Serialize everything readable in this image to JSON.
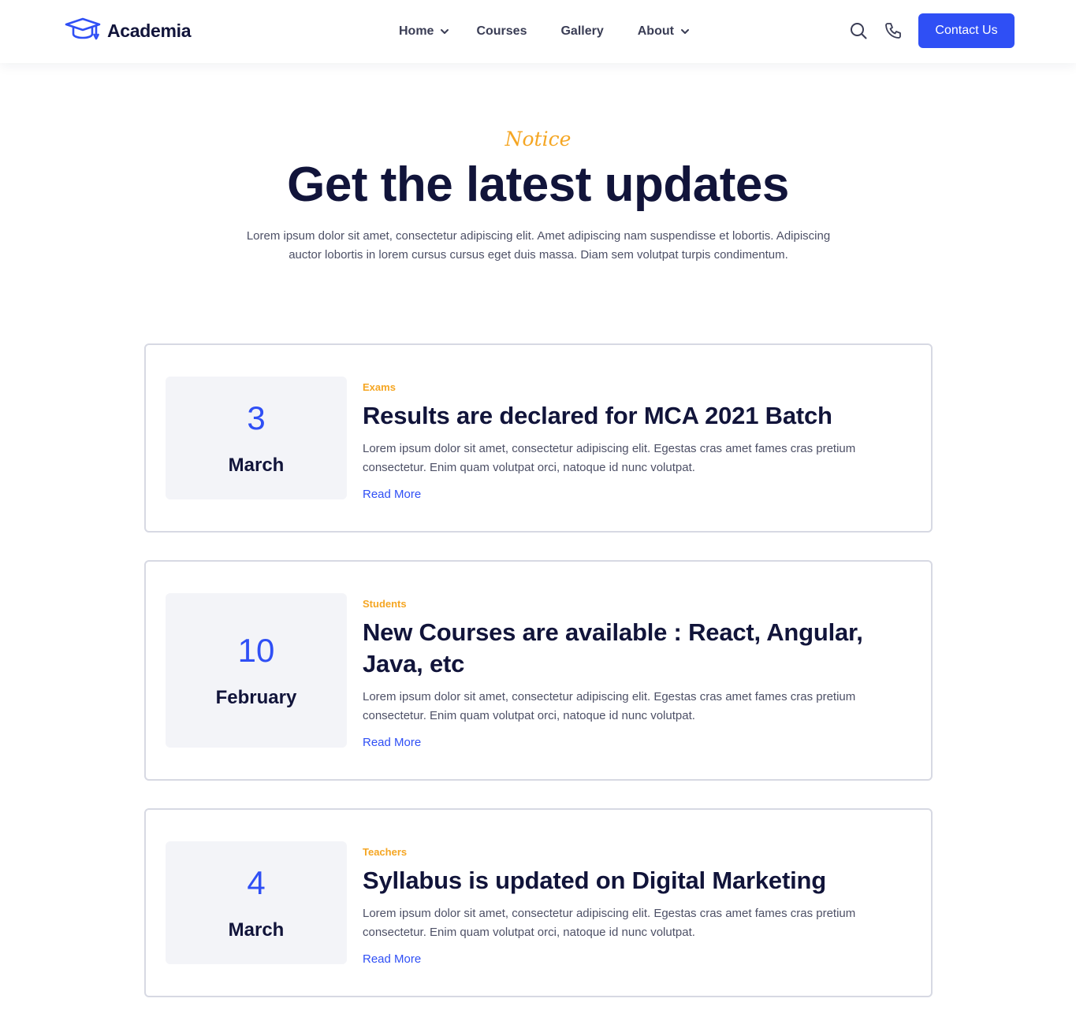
{
  "brand": {
    "name": "Academia",
    "accent": "#2f4ff5",
    "highlight": "#f5a623",
    "logo_icon": "graduation-cap-icon"
  },
  "nav": {
    "items": [
      {
        "label": "Home",
        "has_dropdown": true
      },
      {
        "label": "Courses",
        "has_dropdown": false
      },
      {
        "label": "Gallery",
        "has_dropdown": false
      },
      {
        "label": "About",
        "has_dropdown": true
      }
    ],
    "icons": [
      "search-icon",
      "phone-icon"
    ],
    "cta_label": "Contact Us"
  },
  "section": {
    "eyebrow": "Notice",
    "title": "Get the latest updates",
    "description": "Lorem ipsum dolor sit amet, consectetur adipiscing elit. Amet adipiscing nam suspendisse et lobortis. Adipiscing auctor lobortis in lorem cursus cursus eget duis massa. Diam sem volutpat turpis condimentum."
  },
  "notices": [
    {
      "day": "3",
      "month": "March",
      "category": "Exams",
      "title": "Results are declared for MCA 2021 Batch",
      "text": "Lorem ipsum dolor sit amet, consectetur adipiscing elit. Egestas cras amet fames cras pretium consectetur. Enim quam volutpat orci, natoque id nunc volutpat.",
      "link_label": "Read More"
    },
    {
      "day": "10",
      "month": "February",
      "category": "Students",
      "title": "New Courses are available : React, Angular, Java, etc",
      "text": "Lorem ipsum dolor sit amet, consectetur adipiscing elit. Egestas cras amet fames cras pretium consectetur. Enim quam volutpat orci, natoque id nunc volutpat.",
      "link_label": "Read More"
    },
    {
      "day": "4",
      "month": "March",
      "category": "Teachers",
      "title": "Syllabus is updated on Digital Marketing",
      "text": "Lorem ipsum dolor sit amet, consectetur adipiscing elit. Egestas cras amet fames cras pretium consectetur. Enim quam volutpat orci, natoque id nunc volutpat.",
      "link_label": "Read More"
    }
  ]
}
